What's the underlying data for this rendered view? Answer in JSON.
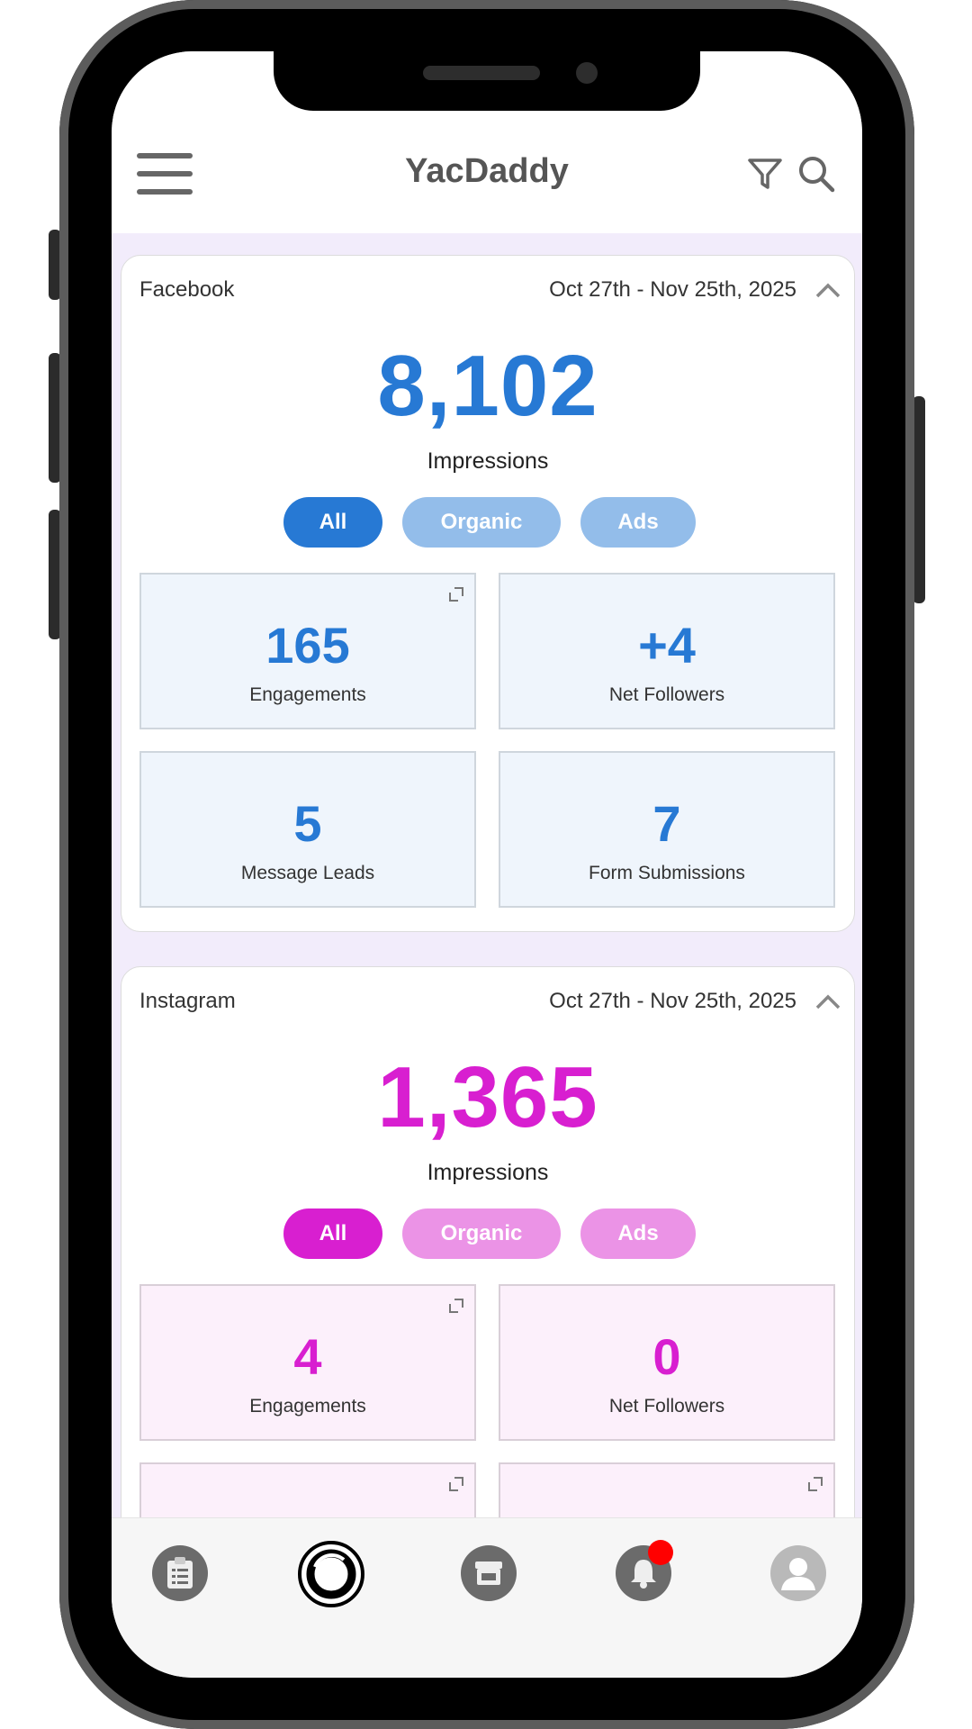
{
  "app": {
    "title": "YacDaddy"
  },
  "colors": {
    "facebook": "#2779d4",
    "instagram": "#d81fd0"
  },
  "facebook": {
    "platform": "Facebook",
    "date_range": "Oct 27th - Nov 25th, 2025",
    "impressions_value": "8,102",
    "impressions_label": "Impressions",
    "filters": [
      "All",
      "Organic",
      "Ads"
    ],
    "selected_filter": "All",
    "tiles": [
      {
        "value": "165",
        "label": "Engagements"
      },
      {
        "value": "+4",
        "label": "Net Followers"
      },
      {
        "value": "5",
        "label": "Message Leads"
      },
      {
        "value": "7",
        "label": "Form Submissions"
      }
    ]
  },
  "instagram": {
    "platform": "Instagram",
    "date_range": "Oct 27th - Nov 25th, 2025",
    "impressions_value": "1,365",
    "impressions_label": "Impressions",
    "filters": [
      "All",
      "Organic",
      "Ads"
    ],
    "selected_filter": "All",
    "tiles": [
      {
        "value": "4",
        "label": "Engagements"
      },
      {
        "value": "0",
        "label": "Net Followers"
      }
    ]
  },
  "bottom_nav": {
    "items": [
      "clipboard-icon",
      "logo-ring-icon",
      "store-icon",
      "bell-icon",
      "avatar-icon"
    ],
    "notification_badge": true
  }
}
